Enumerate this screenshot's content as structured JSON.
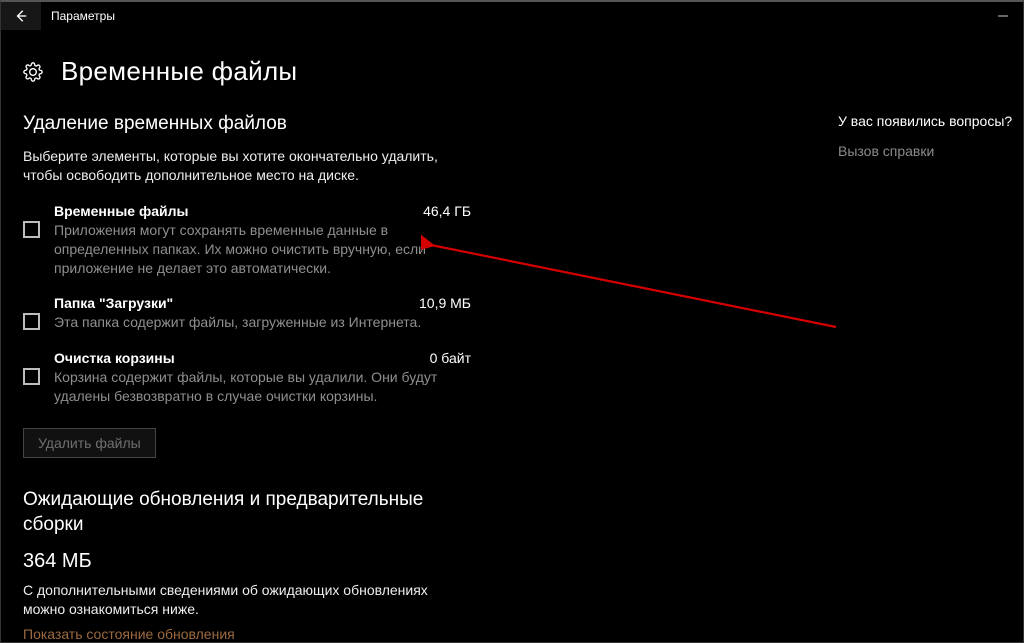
{
  "titlebar": {
    "app_title": "Параметры"
  },
  "header": {
    "page_title": "Временные файлы"
  },
  "side": {
    "heading": "У вас появились вопросы?",
    "help_link": "Вызов справки"
  },
  "temp": {
    "section_title": "Удаление временных файлов",
    "section_desc": "Выберите элементы, которые вы хотите окончательно удалить, чтобы освободить дополнительное место на диске.",
    "items": [
      {
        "title": "Временные файлы",
        "size": "46,4 ГБ",
        "desc": "Приложения могут сохранять временные данные в определенных папках. Их можно очистить вручную, если приложение не делает это автоматически."
      },
      {
        "title": "Папка \"Загрузки\"",
        "size": "10,9 МБ",
        "desc": "Эта папка содержит файлы, загруженные из Интернета."
      },
      {
        "title": "Очистка корзины",
        "size": "0 байт",
        "desc": "Корзина содержит файлы, которые вы удалили. Они будут удалены безвозвратно в случае очистки корзины."
      }
    ],
    "delete_btn": "Удалить файлы"
  },
  "pending": {
    "section_title": "Ожидающие обновления и предварительные сборки",
    "size": "364 МБ",
    "info": "С дополнительными сведениями об ожидающих обновлениях можно ознакомиться ниже.",
    "link": "Показать состояние обновления"
  }
}
